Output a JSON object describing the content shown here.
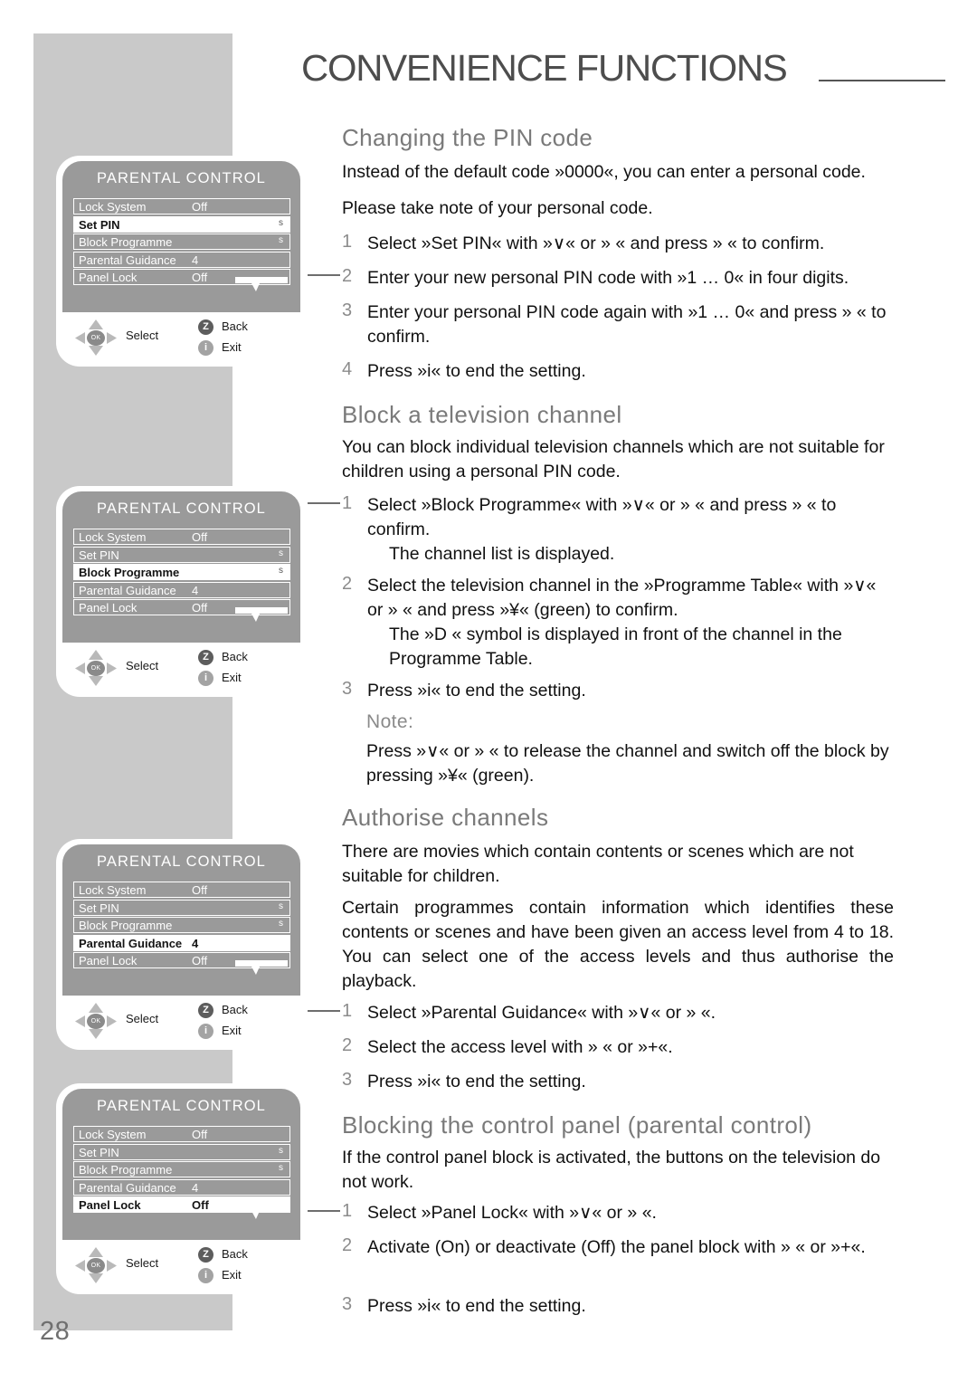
{
  "page": {
    "chapter_title": "CONVENIENCE FUNCTIONS",
    "page_number": "28"
  },
  "sections": [
    {
      "heading": "Changing the PIN code",
      "paragraphs": [
        "Instead of the default code »0000«, you can enter a personal code.",
        "Please take note of your personal code."
      ],
      "steps": [
        {
          "num": "1",
          "text": "Select »Set PIN« with »∨« or »  « and press »  « to confirm."
        },
        {
          "num": "2",
          "text": "Enter your new personal PIN code with »1 … 0« in four digits."
        },
        {
          "num": "3",
          "text": "Enter your personal PIN code again with »1 … 0« and press »  « to confirm."
        },
        {
          "num": "4",
          "text": "Press »i« to end the setting."
        }
      ]
    },
    {
      "heading": "Block a television channel",
      "paragraphs": [
        "You can block individual television channels which are not suitable for children using a personal PIN code."
      ],
      "steps": [
        {
          "num": "1",
          "text": "Select »Block Programme« with »∨« or »  « and press »  « to confirm.",
          "sub": "The channel list is displayed."
        },
        {
          "num": "2",
          "text": "Select the television channel in the »Programme Table« with »∨« or »  « and press »¥« (green) to confirm.",
          "sub": "The »D « symbol is displayed in front of the channel in the Programme Table."
        },
        {
          "num": "3",
          "text": "Press »i« to end the setting."
        }
      ],
      "note": {
        "label": "Note:",
        "text": "Press »∨« or »  « to release the channel and switch off the block by pressing »¥« (green)."
      }
    },
    {
      "heading": "Authorise channels",
      "paragraphs": [
        "There are movies which contain contents or scenes which are not suitable for children.",
        "Certain programmes contain information which identifies these contents or scenes and have been given an access level from 4 to 18. You can select one of the access levels and thus authorise the playback."
      ],
      "steps": [
        {
          "num": "1",
          "text": "Select »Parental Guidance« with »∨« or »  «."
        },
        {
          "num": "2",
          "text": "Select the access level with »  « or »+«."
        },
        {
          "num": "3",
          "text": "Press »i« to end the setting."
        }
      ]
    },
    {
      "heading": "Blocking the control panel (parental control)",
      "paragraphs": [
        "If the control panel block is activated, the buttons on the television do not work."
      ],
      "steps": [
        {
          "num": "1",
          "text": "Select »Panel Lock« with »∨« or »  «."
        },
        {
          "num": "2",
          "text": "Activate (On) or deactivate (Off) the panel block with »  « or »+«."
        },
        {
          "num": "3",
          "text": "Press »i« to end the setting."
        }
      ]
    }
  ],
  "tv_menus": [
    {
      "title": "PARENTAL CONTROL",
      "selected": 1,
      "rows": [
        {
          "label": "Lock System",
          "value": "Off",
          "align": "mid"
        },
        {
          "label": "Set PIN",
          "value": "s",
          "align": "right"
        },
        {
          "label": "Block Programme",
          "value": "s",
          "align": "right"
        },
        {
          "label": "Parental Guidance",
          "value": "4",
          "align": "mid"
        },
        {
          "label": "Panel Lock",
          "value": "Off",
          "align": "mid"
        }
      ],
      "footer": {
        "select": "Select",
        "ok": "OK",
        "back_badge": "Z",
        "back": "Back",
        "exit_badge": "i",
        "exit": "Exit"
      }
    },
    {
      "title": "PARENTAL CONTROL",
      "selected": 2,
      "rows": [
        {
          "label": "Lock System",
          "value": "Off",
          "align": "mid"
        },
        {
          "label": "Set PIN",
          "value": "s",
          "align": "right"
        },
        {
          "label": "Block Programme",
          "value": "s",
          "align": "right"
        },
        {
          "label": "Parental Guidance",
          "value": "4",
          "align": "mid"
        },
        {
          "label": "Panel Lock",
          "value": "Off",
          "align": "mid"
        }
      ],
      "footer": {
        "select": "Select",
        "ok": "OK",
        "back_badge": "Z",
        "back": "Back",
        "exit_badge": "i",
        "exit": "Exit"
      }
    },
    {
      "title": "PARENTAL CONTROL",
      "selected": 3,
      "rows": [
        {
          "label": "Lock System",
          "value": "Off",
          "align": "mid"
        },
        {
          "label": "Set PIN",
          "value": "s",
          "align": "right"
        },
        {
          "label": "Block Programme",
          "value": "s",
          "align": "right"
        },
        {
          "label": "Parental Guidance",
          "value": "4",
          "align": "mid"
        },
        {
          "label": "Panel Lock",
          "value": "Off",
          "align": "mid"
        }
      ],
      "footer": {
        "select": "Select",
        "ok": "OK",
        "back_badge": "Z",
        "back": "Back",
        "exit_badge": "i",
        "exit": "Exit"
      }
    },
    {
      "title": "PARENTAL CONTROL",
      "selected": 4,
      "rows": [
        {
          "label": "Lock System",
          "value": "Off",
          "align": "mid"
        },
        {
          "label": "Set PIN",
          "value": "s",
          "align": "right"
        },
        {
          "label": "Block Programme",
          "value": "s",
          "align": "right"
        },
        {
          "label": "Parental Guidance",
          "value": "4",
          "align": "mid"
        },
        {
          "label": "Panel Lock",
          "value": "Off",
          "align": "mid"
        }
      ],
      "footer": {
        "select": "Select",
        "ok": "OK",
        "back_badge": "Z",
        "back": "Back",
        "exit_badge": "i",
        "exit": "Exit"
      }
    }
  ],
  "colors": {
    "band": "#c9c9c9",
    "menu_bg": "#9a9a9a",
    "heading": "#7a7a7a",
    "title": "#4d4d4d"
  }
}
